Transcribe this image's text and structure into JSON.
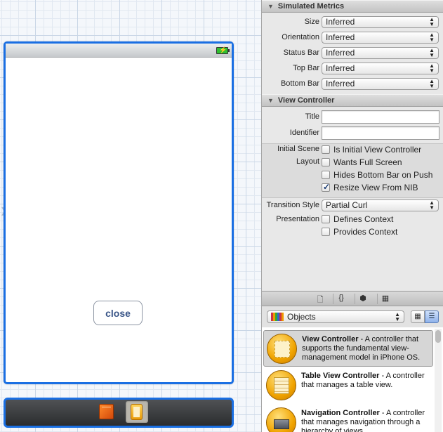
{
  "canvas": {
    "close_button": "close"
  },
  "inspector": {
    "simulated_metrics": {
      "header": "Simulated Metrics",
      "rows": [
        {
          "label": "Size",
          "value": "Inferred"
        },
        {
          "label": "Orientation",
          "value": "Inferred"
        },
        {
          "label": "Status Bar",
          "value": "Inferred"
        },
        {
          "label": "Top Bar",
          "value": "Inferred"
        },
        {
          "label": "Bottom Bar",
          "value": "Inferred"
        }
      ]
    },
    "view_controller": {
      "header": "View Controller",
      "title_label": "Title",
      "title_value": "",
      "identifier_label": "Identifier",
      "identifier_value": "",
      "initial_scene_label": "Initial Scene",
      "initial_scene_option": "Is Initial View Controller",
      "layout_label": "Layout",
      "layout_options": [
        {
          "label": "Wants Full Screen",
          "checked": false
        },
        {
          "label": "Hides Bottom Bar on Push",
          "checked": false
        },
        {
          "label": "Resize View From NIB",
          "checked": true
        }
      ],
      "transition_style_label": "Transition Style",
      "transition_style_value": "Partial Curl",
      "presentation_label": "Presentation",
      "presentation_options": [
        {
          "label": "Defines Context",
          "checked": false
        },
        {
          "label": "Provides Context",
          "checked": false
        }
      ]
    }
  },
  "library": {
    "tabs": [
      "file-icon",
      "braces-icon",
      "cube-icon",
      "media-icon"
    ],
    "filter_value": "Objects",
    "items": [
      {
        "title": "View Controller",
        "desc": " - A controller that supports the fundamental view-management model in iPhone OS."
      },
      {
        "title": "Table View Controller",
        "desc": " - A controller that manages a table view."
      },
      {
        "title": "Navigation Controller",
        "desc": " - A controller that manages navigation through a hierarchy of views."
      }
    ]
  }
}
